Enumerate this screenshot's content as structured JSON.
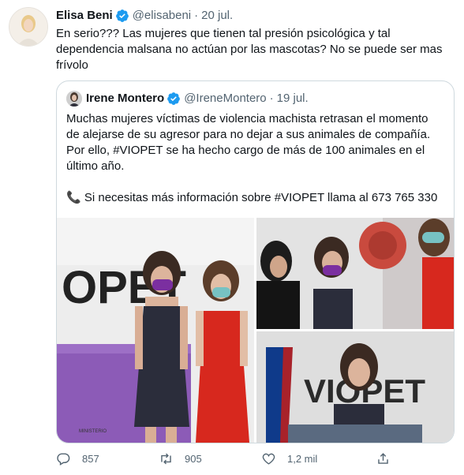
{
  "tweet": {
    "author_name": "Elisa Beni",
    "author_handle": "@elisabeni",
    "date": "20 jul.",
    "separator": "·",
    "text": "En serio??? Las mujeres que tienen tal presión psicológica y tal\ndependencia malsana no actúan por las mascotas? No se puede ser mas\nfrívolo"
  },
  "quote": {
    "author_name": "Irene Montero",
    "author_handle": "@IreneMontero",
    "date": "19 jul.",
    "separator": "·",
    "text": "Muchas mujeres víctimas de violencia machista retrasan el momento\nde alejarse de su agresor para no dejar a sus animales de compañía.\nPor ello, #VIOPET se ha hecho cargo de más de 100 animales en el\núltimo año.\n\n📞 Si necesitas más información sobre #VIOPET llama al 673 765 330",
    "photo_sign_text": "OPET",
    "photo_sign_text_2": "VIOPET",
    "photo_caption": "MINISTERIO"
  },
  "actions": {
    "replies": "857",
    "retweets": "905",
    "likes": "1,2 mil"
  },
  "colors": {
    "verified": "#1d9bf0",
    "muted": "#536471",
    "border": "#cfd9de",
    "mask_purple": "#7b2fa0",
    "dress_red": "#d7281e"
  }
}
